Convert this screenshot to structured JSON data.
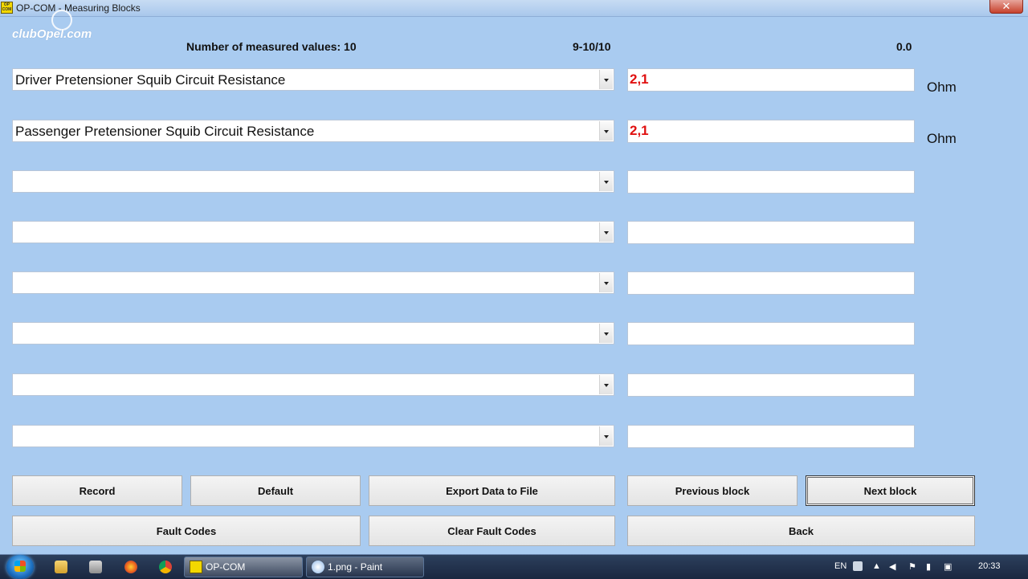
{
  "window": {
    "title": "OP-COM - Measuring Blocks",
    "icon_text": "OP COM",
    "close_symbol": "✕"
  },
  "watermark": "clubOpel.com",
  "header": {
    "count_label": "Number of measured values: 10",
    "range": "9-10/10",
    "time": "0.0"
  },
  "rows": [
    {
      "label": "Driver Pretensioner Squib Circuit Resistance",
      "value": "2,1",
      "unit": "Ohm"
    },
    {
      "label": "Passenger Pretensioner Squib Circuit Resistance",
      "value": "2,1",
      "unit": "Ohm"
    },
    {
      "label": "",
      "value": "",
      "unit": ""
    },
    {
      "label": "",
      "value": "",
      "unit": ""
    },
    {
      "label": "",
      "value": "",
      "unit": ""
    },
    {
      "label": "",
      "value": "",
      "unit": ""
    },
    {
      "label": "",
      "value": "",
      "unit": ""
    },
    {
      "label": "",
      "value": "",
      "unit": ""
    }
  ],
  "buttons": {
    "record": "Record",
    "default": "Default",
    "export": "Export Data to File",
    "previous": "Previous block",
    "next": "Next block",
    "fault_codes": "Fault Codes",
    "clear_fault_codes": "Clear Fault Codes",
    "back": "Back"
  },
  "taskbar": {
    "task_opcom": "OP-COM",
    "task_paint": "1.png - Paint",
    "language": "EN",
    "clock": "20:33"
  },
  "colors": {
    "background": "#a9cbf0",
    "value_text": "#e01010"
  }
}
